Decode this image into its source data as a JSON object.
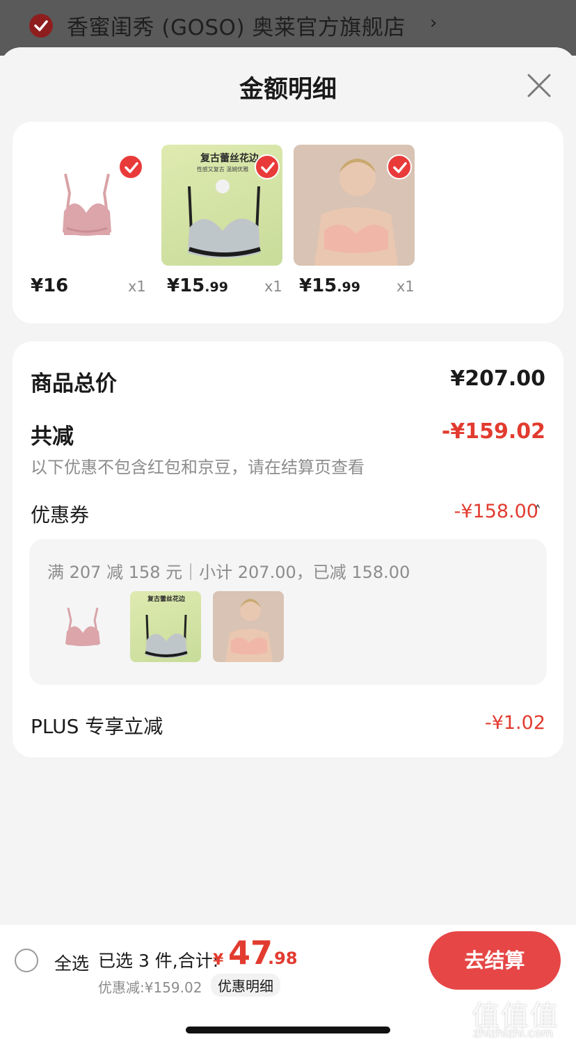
{
  "store": {
    "name": "香蜜闺秀 (GOSO) 奥莱官方旗舰店",
    "arrow": "›"
  },
  "sheet": {
    "title": "金额明细"
  },
  "products": [
    {
      "price_int": "¥16",
      "price_dec": "",
      "qty": "x1"
    },
    {
      "price_int": "¥15",
      "price_dec": ".99",
      "qty": "x1",
      "image_caption": "复古蕾丝花边",
      "image_subcaption": "性感又复古 温婉优雅"
    },
    {
      "price_int": "¥15",
      "price_dec": ".99",
      "qty": "x1"
    }
  ],
  "summary": {
    "total_label": "商品总价",
    "total_value": "¥207.00",
    "reduce_label": "共减",
    "reduce_value": "-¥159.02",
    "reduce_note": "以下优惠不包含红包和京豆，请在结算页查看",
    "coupon_label": "优惠券",
    "coupon_value": "-¥158.00",
    "coupon_chevron": "˄",
    "coupon_desc": "满 207 减 158 元｜小计 207.00，已减 158.00",
    "plus_label": "PLUS 专享立减",
    "plus_value": "-¥1.02"
  },
  "bottom": {
    "select_all": "全选",
    "selected_info": "已选 3 件,合计:",
    "sum_symbol": "¥",
    "sum_int": "47",
    "sum_dec": ".98",
    "discount_info": "优惠减:¥159.02",
    "detail_link": "优惠明细",
    "checkout": "去结算"
  },
  "watermark": {
    "glyphs": "值值值",
    "domain": "zhizhizhi.com"
  },
  "colors": {
    "accent": "#e23b2f",
    "button": "#e64646",
    "check": "#e93a3a"
  }
}
